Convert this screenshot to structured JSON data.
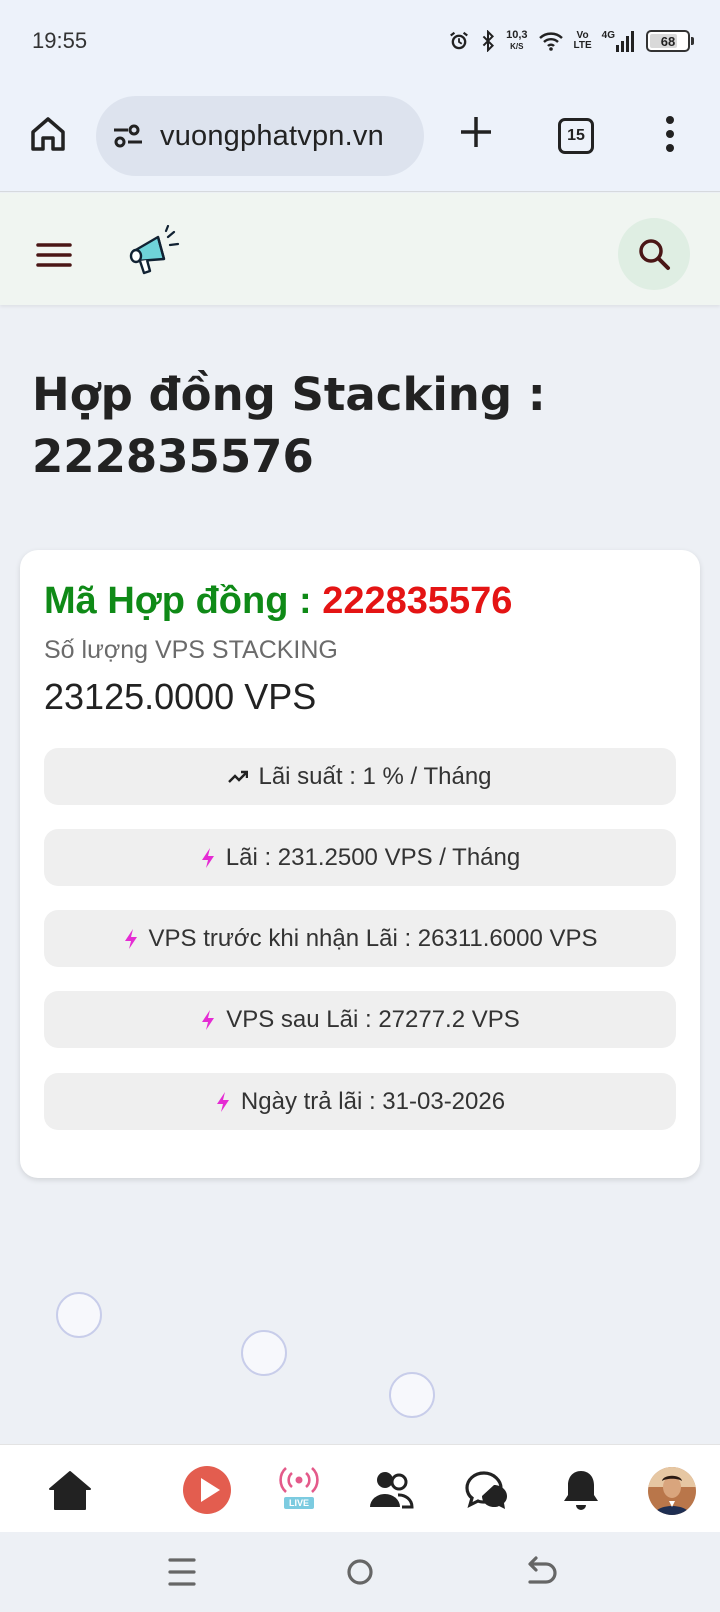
{
  "status_bar": {
    "time": "19:55",
    "net_speed_value": "10,3",
    "net_speed_unit": "K/S",
    "volte_top": "Vo",
    "volte_bottom": "LTE",
    "network": "4G",
    "battery": "68"
  },
  "browser": {
    "url": "vuongphatvpn.vn",
    "tab_count": "15"
  },
  "page": {
    "title": "Hợp đồng Stacking : 222835576"
  },
  "card": {
    "contract_label": "Mã Hợp đồng : ",
    "contract_id": "222835576",
    "quantity_label": "Số lượng VPS STACKING",
    "quantity_value": "23125.0000 VPS",
    "rows": [
      {
        "icon": "trend-up-icon",
        "text": "Lãi suất : 1 % / Tháng"
      },
      {
        "icon": "bolt-icon",
        "text": "Lãi : 231.2500 VPS / Tháng"
      },
      {
        "icon": "bolt-icon",
        "text": "VPS trước khi nhận Lãi : 26311.6000 VPS"
      },
      {
        "icon": "bolt-icon",
        "text": "VPS sau Lãi : 27277.2 VPS"
      },
      {
        "icon": "bolt-icon",
        "text": "Ngày trả lãi : 31-03-2026"
      }
    ]
  },
  "bottom_nav": {
    "live_badge": "LIVE",
    "items": [
      "home-icon",
      "play-icon",
      "live-icon",
      "users-icon",
      "chat-icon",
      "bell-icon",
      "avatar"
    ]
  },
  "colors": {
    "contract_label": "#0f8a17",
    "contract_id": "#e41414",
    "bolt": "#e52bd3",
    "play": "#e35d4f"
  }
}
